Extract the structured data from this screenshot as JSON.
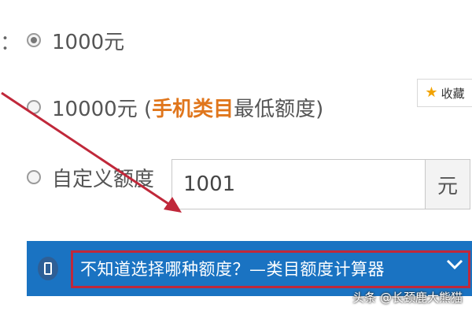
{
  "form": {
    "label_suffix": "：",
    "options": [
      {
        "label": "1000元",
        "checked": true
      },
      {
        "label_prefix": "10000元 (",
        "label_highlight": "手机类目",
        "label_suffix": "最低额度)",
        "checked": false
      },
      {
        "label": "自定义额度",
        "checked": false
      }
    ],
    "custom_amount": {
      "value": "1001",
      "unit": "元"
    }
  },
  "favorite": {
    "label": "收藏",
    "icon": "star-icon"
  },
  "calculator_bar": {
    "text": "不知道选择哪种额度？—类目额度计算器",
    "icon": "phone-icon",
    "expand_icon": "chevron-down-icon"
  },
  "watermark": "头条 @长颈鹿大熊猫",
  "colors": {
    "highlight": "#e0761c",
    "bar": "#1a73c2",
    "annotation": "#c0283a"
  }
}
